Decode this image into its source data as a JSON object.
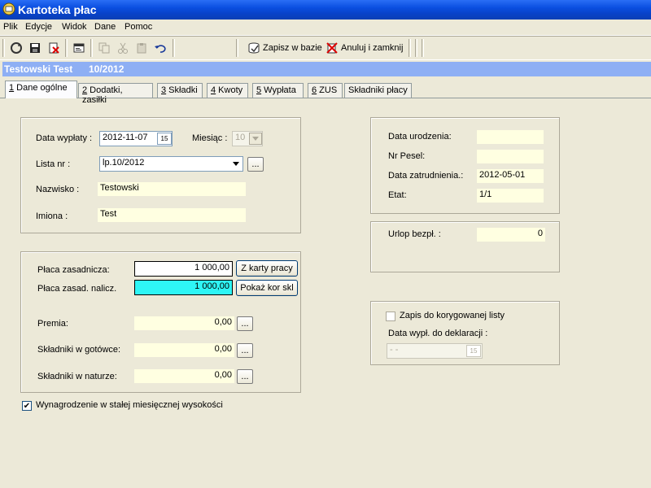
{
  "window": {
    "title": "Kartoteka płac"
  },
  "menu": {
    "items": [
      "Plik",
      "Edycje",
      "Widok",
      "Dane",
      "Pomoc"
    ]
  },
  "toolbar": {
    "save_label": "Zapisz w bazie",
    "cancel_label": "Anuluj i zamknij"
  },
  "header": {
    "name": "Testowski Test",
    "period": "10/2012"
  },
  "tabs": [
    {
      "key": "1",
      "label": " Dane ogólne"
    },
    {
      "key": "2",
      "label": " Dodatki, zasiłki"
    },
    {
      "key": "3",
      "label": " Składki"
    },
    {
      "key": "4",
      "label": " Kwoty"
    },
    {
      "key": "5",
      "label": " Wypłata"
    },
    {
      "key": "6",
      "label": " ZUS"
    },
    {
      "key": "",
      "label": "Składniki płacy"
    }
  ],
  "general": {
    "payout_date_label": "Data wypłaty :",
    "payout_date": "2012-11-07",
    "month_label": "Miesiąc :",
    "month": "10",
    "list_label": "Lista nr :",
    "list": "lp.10/2012",
    "surname_label": "Nazwisko :",
    "surname": "Testowski",
    "names_label": "Imiona :",
    "names": "Test"
  },
  "salary": {
    "base_label": "Płaca zasadnicza:",
    "base": "1 000,00",
    "from_card_label": "Z karty pracy",
    "base_calc_label": "Płaca zasad. nalicz.",
    "base_calc": "1 000,00",
    "show_kor_label": "Pokaż kor skl",
    "bonus_label": "Premia:",
    "bonus": "0,00",
    "cash_label": "Składniki w gotówce:",
    "cash": "0,00",
    "kind_label": "Składniki w naturze:",
    "kind": "0,00"
  },
  "fixed_salary": {
    "label": "Wynagrodzenie w stałej miesięcznej wysokości",
    "checked": true
  },
  "personal": {
    "birth_label": "Data urodzenia:",
    "birth": "",
    "pesel_label": "Nr Pesel:",
    "pesel": "",
    "hire_label": "Data zatrudnienia.:",
    "hire": "2012-05-01",
    "etat_label": "Etat:",
    "etat": "1/1"
  },
  "leave": {
    "label": "Urlop bezpł. :",
    "value": "0"
  },
  "correction": {
    "checkbox_label": "Zapis do korygowanej listy",
    "decl_label": "Data wypł. do deklaracji :",
    "decl_value": " -  -"
  },
  "glyphs": {
    "ellipsis": "...",
    "calendar": "15",
    "check": "✔"
  },
  "colors": {
    "title": "#0a4ee0",
    "header": "#8eaff4",
    "highlight": "#2ef5f5",
    "readonly": "#ffffe1"
  }
}
